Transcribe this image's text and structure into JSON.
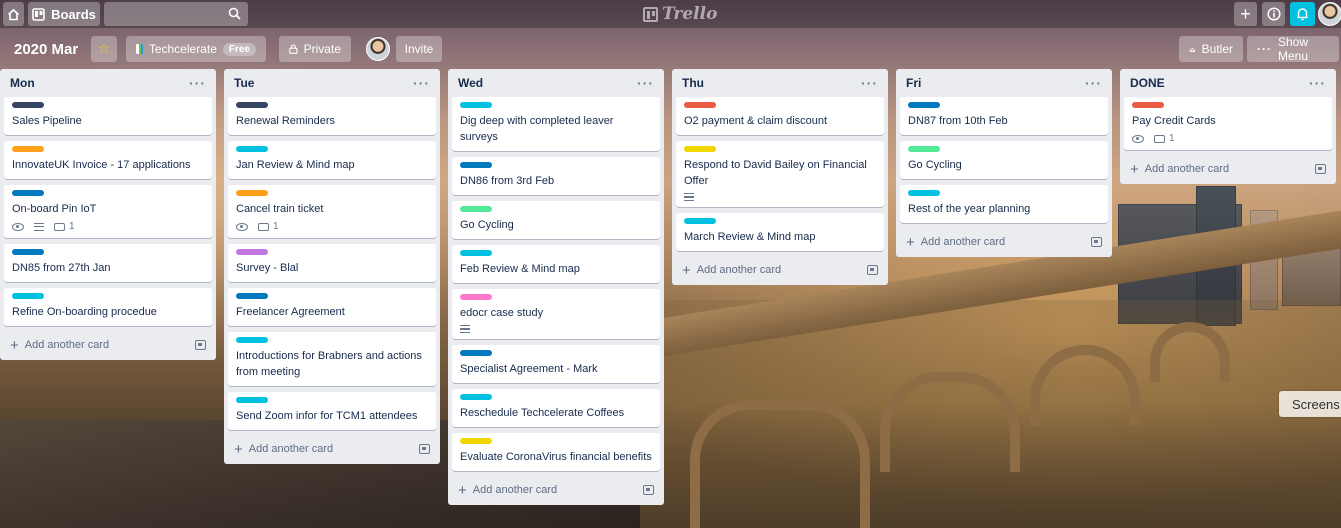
{
  "header": {
    "home_icon": "home-icon",
    "boards_label": "Boards",
    "search_placeholder": "",
    "logo_text": "Trello",
    "add_icon": "plus-icon",
    "info_icon": "info-icon",
    "notifications_icon": "bell-icon"
  },
  "board": {
    "title": "2020 Mar",
    "team_name": "Techcelerate",
    "team_badge": "Free",
    "visibility": "Private",
    "invite_label": "Invite",
    "butler_label": "Butler",
    "show_menu_label": "Show Menu"
  },
  "colors": {
    "navy": "#344563",
    "orange": "#ff9f1a",
    "blue": "#0079bf",
    "sky": "#00c2e0",
    "pink": "#ff78cb",
    "purple": "#c377e0",
    "green": "#51e898",
    "red": "#eb5a46",
    "yellow": "#f2d600"
  },
  "add_card_label": "Add another card",
  "lists": [
    {
      "name": "Mon",
      "cards": [
        {
          "title": "Sales Pipeline",
          "label": "navy"
        },
        {
          "title": "InnovateUK Invoice - 17 applications",
          "label": "orange"
        },
        {
          "title": "On-board Pin IoT",
          "label": "blue",
          "watch": true,
          "desc": true,
          "comments": "1"
        },
        {
          "title": "DN85 from 27th Jan",
          "label": "blue"
        },
        {
          "title": "Refine On-boarding procedue",
          "label": "sky"
        }
      ]
    },
    {
      "name": "Tue",
      "cards": [
        {
          "title": "Renewal Reminders",
          "label": "navy"
        },
        {
          "title": "Jan Review & Mind map",
          "label": "sky"
        },
        {
          "title": "Cancel train ticket",
          "label": "orange",
          "watch": true,
          "comments": "1"
        },
        {
          "title": "Survey - Blal",
          "label": "purple"
        },
        {
          "title": "Freelancer Agreement",
          "label": "blue"
        },
        {
          "title": "Introductions for Brabners and actions from meeting",
          "label": "sky"
        },
        {
          "title": "Send Zoom infor for TCM1 attendees",
          "label": "sky"
        }
      ]
    },
    {
      "name": "Wed",
      "cards": [
        {
          "title": "Dig deep with completed leaver surveys",
          "label": "sky"
        },
        {
          "title": "DN86 from 3rd Feb",
          "label": "blue"
        },
        {
          "title": "Go Cycling",
          "label": "green"
        },
        {
          "title": "Feb Review & Mind map",
          "label": "sky"
        },
        {
          "title": "edocr case study",
          "label": "pink",
          "desc": true
        },
        {
          "title": "Specialist Agreement - Mark",
          "label": "blue"
        },
        {
          "title": "Reschedule Techcelerate Coffees",
          "label": "sky"
        },
        {
          "title": "Evaluate CoronaVirus financial benefits",
          "label": "yellow"
        }
      ]
    },
    {
      "name": "Thu",
      "cards": [
        {
          "title": "O2 payment & claim discount",
          "label": "red"
        },
        {
          "title": "Respond to David Bailey on Financial Offer",
          "label": "yellow",
          "desc": true
        },
        {
          "title": "March Review & Mind map",
          "label": "sky"
        }
      ]
    },
    {
      "name": "Fri",
      "cards": [
        {
          "title": "DN87 from 10th Feb",
          "label": "blue"
        },
        {
          "title": "Go Cycling",
          "label": "green"
        },
        {
          "title": "Rest of the year planning",
          "label": "sky"
        }
      ]
    },
    {
      "name": "DONE",
      "cards": [
        {
          "title": "Pay Credit Cards",
          "label": "red",
          "watch": true,
          "comments": "1"
        }
      ]
    }
  ],
  "overlay_tab": "Screens"
}
